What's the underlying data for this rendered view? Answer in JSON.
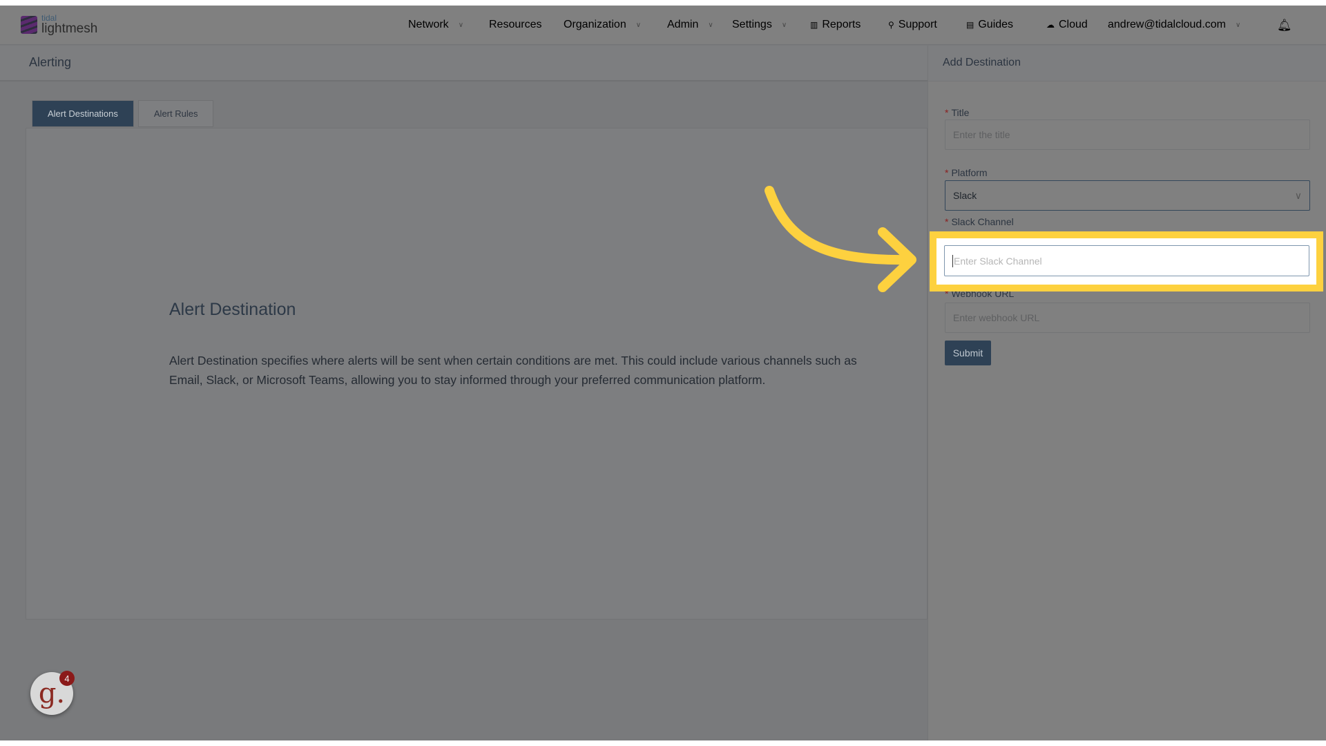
{
  "brand": {
    "small": "tidal",
    "big": "lightmesh"
  },
  "nav": [
    {
      "label": "Network",
      "dropdown": true,
      "icon": ""
    },
    {
      "label": "Resources",
      "dropdown": false,
      "icon": ""
    },
    {
      "label": "Organization",
      "dropdown": true,
      "icon": ""
    },
    {
      "label": "Admin",
      "dropdown": true,
      "icon": ""
    },
    {
      "label": "Settings",
      "dropdown": true,
      "icon": ""
    },
    {
      "label": "Reports",
      "dropdown": false,
      "icon": "bar-chart-icon"
    },
    {
      "label": "Support",
      "dropdown": false,
      "icon": "wrench-icon"
    },
    {
      "label": "Guides",
      "dropdown": false,
      "icon": "book-icon"
    },
    {
      "label": "Cloud",
      "dropdown": false,
      "icon": "cloud-icon"
    },
    {
      "label": "andrew@tidalcloud.com",
      "dropdown": true,
      "icon": ""
    }
  ],
  "page": {
    "title": "Alerting"
  },
  "tabs": [
    {
      "label": "Alert Destinations",
      "active": true
    },
    {
      "label": "Alert Rules",
      "active": false
    }
  ],
  "content": {
    "heading": "Alert Destination",
    "body": "Alert Destination specifies where alerts will be sent when certain conditions are met. This could include various channels such as Email, Slack, or Microsoft Teams, allowing you to stay informed through your preferred communication platform."
  },
  "panel": {
    "title": "Add Destination",
    "title_label": "Title",
    "title_placeholder": "Enter the title",
    "platform_label": "Platform",
    "platform_value": "Slack",
    "channel_label": "Slack Channel",
    "channel_placeholder": "Enter Slack Channel",
    "webhook_label": "Webhook URL",
    "webhook_placeholder": "Enter webhook URL",
    "submit": "Submit"
  },
  "badge": {
    "letter": "g.",
    "count": "4"
  },
  "colors": {
    "highlight": "#fdd13f",
    "primary": "#2e4155",
    "required": "#8a1f1f"
  }
}
